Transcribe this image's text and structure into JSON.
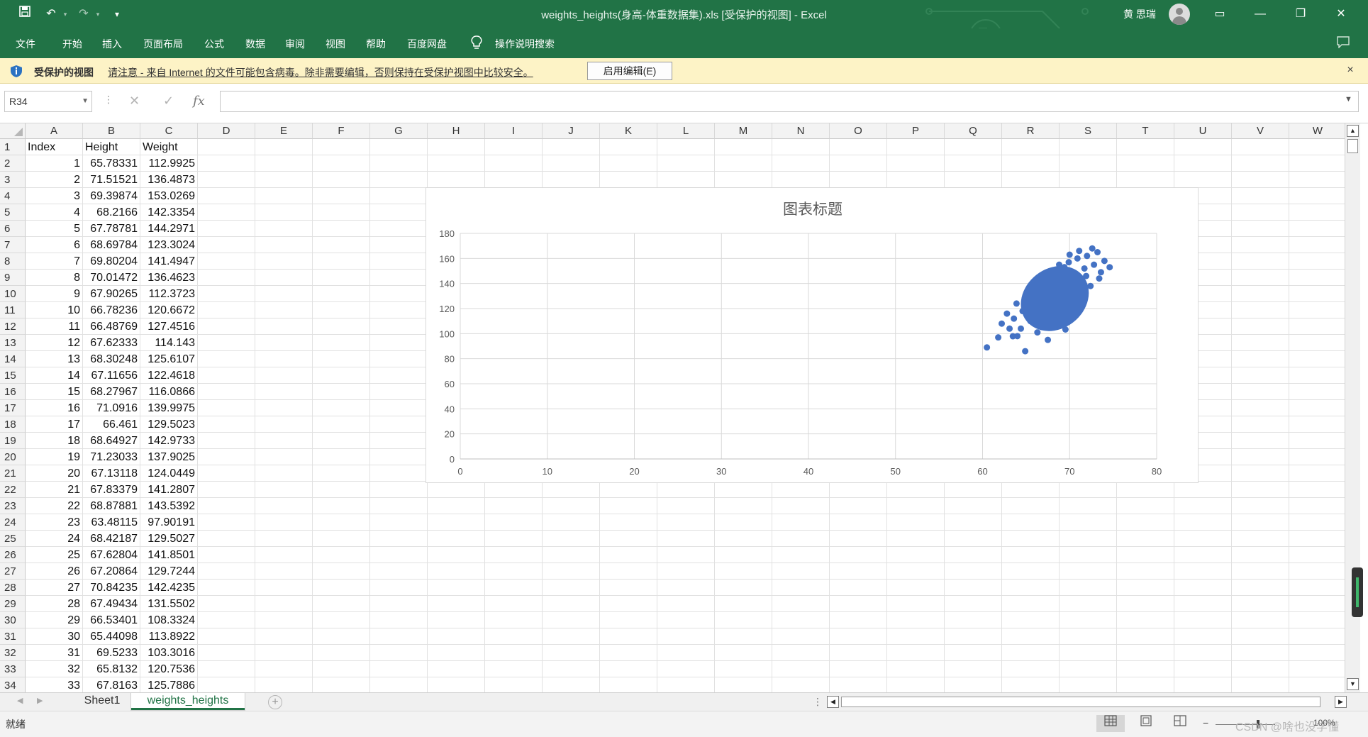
{
  "app": {
    "title": "weights_heights(身高-体重数据集).xls  [受保护的视图]  -  Excel",
    "user_name": "黄 思瑞",
    "accent_color": "#217346"
  },
  "quick_access": {
    "save_icon": "save-icon",
    "undo_icon": "undo-icon",
    "redo_icon": "redo-icon",
    "customize_icon": "customize-qat-icon"
  },
  "window_controls": {
    "ribbon_display": "▭",
    "minimize": "—",
    "restore": "❐",
    "close": "✕"
  },
  "ribbon": {
    "tabs": [
      "文件",
      "开始",
      "插入",
      "页面布局",
      "公式",
      "数据",
      "审阅",
      "视图",
      "帮助",
      "百度网盘"
    ],
    "tell_me": "操作说明搜索",
    "share_icon": "comment-icon"
  },
  "protected_view": {
    "title": "受保护的视图",
    "message": "请注意 - 来自 Internet 的文件可能包含病毒。除非需要编辑，否则保持在受保护视图中比较安全。",
    "button": "启用编辑(E)",
    "close": "×"
  },
  "formula_bar": {
    "name_box": "R34",
    "cancel_icon": "✕",
    "enter_icon": "✓",
    "fx_label": "fx",
    "formula": ""
  },
  "columns": [
    "A",
    "B",
    "C",
    "D",
    "E",
    "F",
    "G",
    "H",
    "I",
    "J",
    "K",
    "L",
    "M",
    "N",
    "O",
    "P",
    "Q",
    "R",
    "S",
    "T",
    "U",
    "V",
    "W"
  ],
  "row_numbers": [
    "1",
    "2",
    "3",
    "4",
    "5",
    "6",
    "7",
    "8",
    "9",
    "10",
    "11",
    "12",
    "13",
    "14",
    "15",
    "16",
    "17",
    "18",
    "19",
    "20",
    "21",
    "22",
    "23",
    "24",
    "25",
    "26",
    "27",
    "28",
    "29",
    "30",
    "31",
    "32",
    "33",
    "34"
  ],
  "table": {
    "headers": [
      "Index",
      "Height",
      "Weight"
    ],
    "rows": [
      [
        "1",
        "65.78331",
        "112.9925"
      ],
      [
        "2",
        "71.51521",
        "136.4873"
      ],
      [
        "3",
        "69.39874",
        "153.0269"
      ],
      [
        "4",
        "68.2166",
        "142.3354"
      ],
      [
        "5",
        "67.78781",
        "144.2971"
      ],
      [
        "6",
        "68.69784",
        "123.3024"
      ],
      [
        "7",
        "69.80204",
        "141.4947"
      ],
      [
        "8",
        "70.01472",
        "136.4623"
      ],
      [
        "9",
        "67.90265",
        "112.3723"
      ],
      [
        "10",
        "66.78236",
        "120.6672"
      ],
      [
        "11",
        "66.48769",
        "127.4516"
      ],
      [
        "12",
        "67.62333",
        "114.143"
      ],
      [
        "13",
        "68.30248",
        "125.6107"
      ],
      [
        "14",
        "67.11656",
        "122.4618"
      ],
      [
        "15",
        "68.27967",
        "116.0866"
      ],
      [
        "16",
        "71.0916",
        "139.9975"
      ],
      [
        "17",
        "66.461",
        "129.5023"
      ],
      [
        "18",
        "68.64927",
        "142.9733"
      ],
      [
        "19",
        "71.23033",
        "137.9025"
      ],
      [
        "20",
        "67.13118",
        "124.0449"
      ],
      [
        "21",
        "67.83379",
        "141.2807"
      ],
      [
        "22",
        "68.87881",
        "143.5392"
      ],
      [
        "23",
        "63.48115",
        "97.90191"
      ],
      [
        "24",
        "68.42187",
        "129.5027"
      ],
      [
        "25",
        "67.62804",
        "141.8501"
      ],
      [
        "26",
        "67.20864",
        "129.7244"
      ],
      [
        "27",
        "70.84235",
        "142.4235"
      ],
      [
        "28",
        "67.49434",
        "131.5502"
      ],
      [
        "29",
        "66.53401",
        "108.3324"
      ],
      [
        "30",
        "65.44098",
        "113.8922"
      ],
      [
        "31",
        "69.5233",
        "103.3016"
      ],
      [
        "32",
        "65.8132",
        "120.7536"
      ],
      [
        "33",
        "67.8163",
        "125.7886"
      ]
    ]
  },
  "chart_data": {
    "type": "scatter",
    "title": "图表标题",
    "xlabel": "",
    "ylabel": "",
    "xlim": [
      0,
      80
    ],
    "ylim": [
      0,
      180
    ],
    "x_ticks": [
      "0",
      "10",
      "20",
      "30",
      "40",
      "50",
      "60",
      "70",
      "80"
    ],
    "y_ticks": [
      "0",
      "20",
      "40",
      "60",
      "80",
      "100",
      "120",
      "140",
      "160",
      "180"
    ],
    "grid": true,
    "legend": "none",
    "marker_color": "#4472C4",
    "series": [
      {
        "x": [
          65.78331,
          71.51521,
          69.39874,
          68.2166,
          67.78781,
          68.69784,
          69.80204,
          70.01472,
          67.90265,
          66.78236,
          66.48769,
          67.62333,
          68.30248,
          67.11656,
          68.27967,
          71.0916,
          66.461,
          68.64927,
          71.23033,
          67.13118,
          67.83379,
          68.87881,
          63.48115,
          68.42187,
          67.62804,
          67.20864,
          70.84235,
          67.49434,
          66.53401,
          65.44098,
          69.5233,
          65.8132,
          67.8163,
          60.5,
          61.8,
          62.2,
          63.1,
          63.6,
          64.0,
          64.6,
          64.9,
          65.2,
          65.5,
          66.0,
          66.3,
          66.9,
          67.3,
          67.5,
          67.9,
          68.1,
          68.5,
          68.9,
          69.1,
          69.3,
          69.6,
          69.9,
          70.2,
          70.5,
          70.9,
          71.3,
          71.7,
          72.0,
          72.4,
          72.8,
          73.2,
          73.6,
          74.0,
          74.6,
          62.8,
          63.9,
          64.4,
          65.0,
          65.9,
          66.6,
          67.0,
          67.7,
          68.3,
          68.8,
          69.4,
          70.0,
          70.6,
          71.1,
          71.9,
          72.6,
          73.4
        ],
        "y": [
          112.9925,
          136.4873,
          153.0269,
          142.3354,
          144.2971,
          123.3024,
          141.4947,
          136.4623,
          112.3723,
          120.6672,
          127.4516,
          114.143,
          125.6107,
          122.4618,
          116.0866,
          139.9975,
          129.5023,
          142.9733,
          137.9025,
          124.0449,
          141.2807,
          143.5392,
          97.90191,
          129.5027,
          141.8501,
          129.7244,
          142.4235,
          131.5502,
          108.3324,
          113.8922,
          103.3016,
          120.7536,
          125.7886,
          89.0,
          97.0,
          108.0,
          104.0,
          112.0,
          98.0,
          118.0,
          86.0,
          126.0,
          110.0,
          132.0,
          101.0,
          119.0,
          140.0,
          95.0,
          128.0,
          134.0,
          117.0,
          146.0,
          124.0,
          150.0,
          135.0,
          157.0,
          129.0,
          148.0,
          160.0,
          142.0,
          152.0,
          162.0,
          138.0,
          155.0,
          165.0,
          149.0,
          158.0,
          153.0,
          116.0,
          124.0,
          104.0,
          130.0,
          114.0,
          138.0,
          108.0,
          147.0,
          121.0,
          155.0,
          131.0,
          163.0,
          140.0,
          166.0,
          146.0,
          168.0,
          144.0
        ]
      }
    ]
  },
  "sheet_tabs": {
    "tabs": [
      "Sheet1",
      "weights_heights"
    ],
    "active": "weights_heights",
    "add": "+"
  },
  "status_bar": {
    "ready": "就绪",
    "zoom_minus": "−",
    "zoom": "100%",
    "watermark": "CSDN @啥也没学懂"
  }
}
